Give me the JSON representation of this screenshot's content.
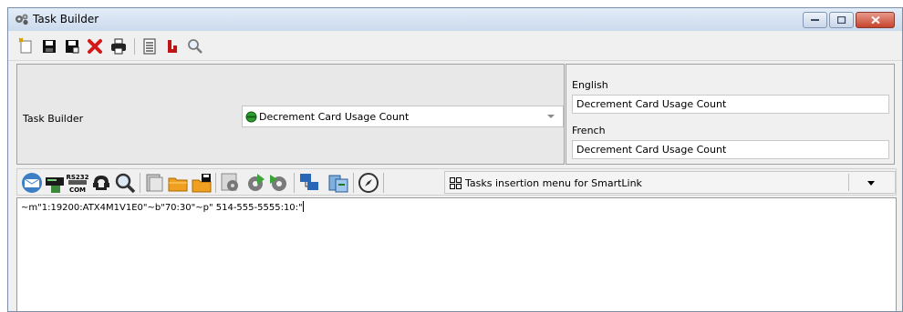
{
  "window": {
    "title": "Task Builder",
    "title_icon": "gear-cluster-icon"
  },
  "toolbar": {
    "buttons": [
      {
        "name": "new-icon",
        "color": "#d4a000"
      },
      {
        "name": "save-icon",
        "color": "#111111"
      },
      {
        "name": "save-as-icon",
        "color": "#111111"
      },
      {
        "name": "delete-icon",
        "color": "#d21a1a"
      },
      {
        "name": "print-icon",
        "color": "#222222"
      },
      {
        "name": "list-icon",
        "color": "#333333"
      },
      {
        "name": "link-icon",
        "color": "#c01515"
      },
      {
        "name": "search-icon",
        "color": "#7a7a7a"
      }
    ]
  },
  "task": {
    "label": "Task Builder",
    "selected": "Decrement Card Usage Count",
    "status_color": "#2e9e2e"
  },
  "languages": {
    "english_label": "English",
    "english_value": "Decrement Card Usage Count",
    "french_label": "French",
    "french_value": "Decrement Card Usage Count"
  },
  "insert_menu": {
    "label": "Tasks insertion menu for SmartLink",
    "icons": [
      "email-icon",
      "terminal-icon",
      "rs232-com-icon",
      "phone-icon",
      "search-card-icon",
      "folder-icon",
      "open-folder-icon",
      "save-folder-icon",
      "settings-icon",
      "gear-add-icon",
      "gear-remove-icon",
      "network-icon",
      "transfer-icon",
      "compass-icon"
    ],
    "rs232_text": "RS232",
    "com_text": "COM"
  },
  "editor": {
    "content": "~m\"1:19200:ATX4M1V1E0\"~b\"70:30\"~p\" 514-555-5555:10:\""
  }
}
